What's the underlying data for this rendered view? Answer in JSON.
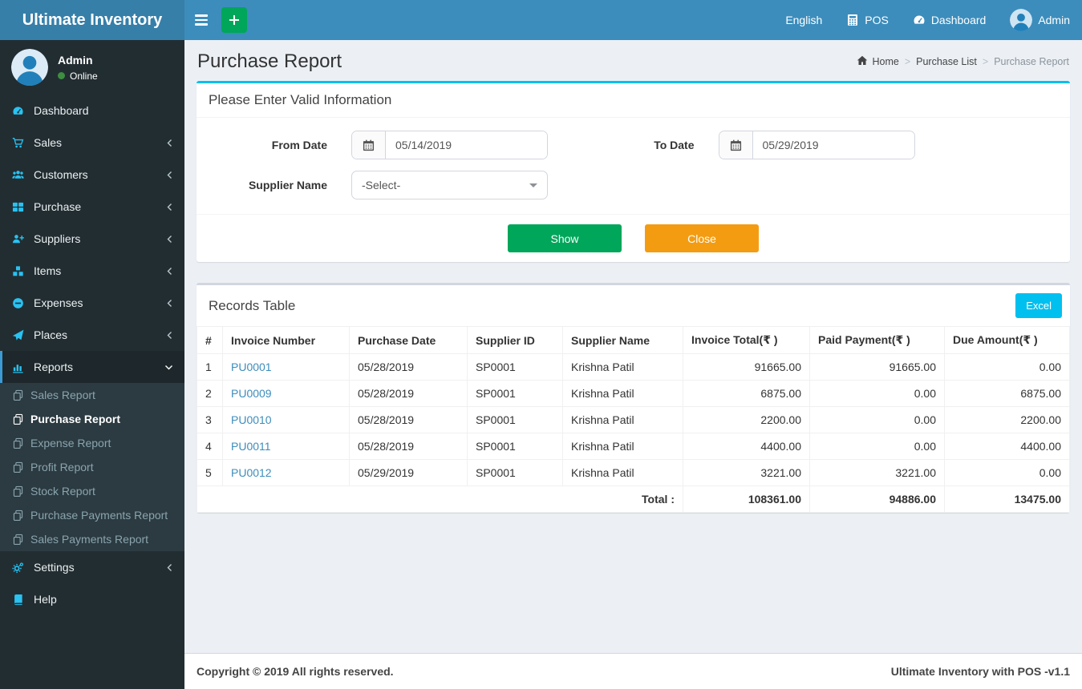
{
  "app": {
    "name": "Ultimate Inventory",
    "footer_left": "Copyright © 2019 All rights reserved.",
    "footer_right": "Ultimate Inventory with POS -v1.1"
  },
  "navbar": {
    "language": "English",
    "pos": "POS",
    "dashboard": "Dashboard",
    "user": "Admin",
    "icons": [
      "calculator-icon",
      "tachometer-icon",
      "user-avatar"
    ]
  },
  "sidebar": {
    "user": {
      "name": "Admin",
      "status": "Online"
    },
    "menu": [
      {
        "label": "Dashboard",
        "icon": "tachometer-icon",
        "arrow": "none",
        "active": false
      },
      {
        "label": "Sales",
        "icon": "cart-icon",
        "arrow": "left",
        "active": false
      },
      {
        "label": "Customers",
        "icon": "users-icon",
        "arrow": "left",
        "active": false
      },
      {
        "label": "Purchase",
        "icon": "th-large-icon",
        "arrow": "left",
        "active": false
      },
      {
        "label": "Suppliers",
        "icon": "user-plus-icon",
        "arrow": "left",
        "active": false
      },
      {
        "label": "Items",
        "icon": "cubes-icon",
        "arrow": "left",
        "active": false
      },
      {
        "label": "Expenses",
        "icon": "minus-circle-icon",
        "arrow": "left",
        "active": false
      },
      {
        "label": "Places",
        "icon": "paper-plane-icon",
        "arrow": "left",
        "active": false
      },
      {
        "label": "Reports",
        "icon": "bar-chart-icon",
        "arrow": "down",
        "active": true,
        "expanded": true
      },
      {
        "label": "Settings",
        "icon": "gears-icon",
        "arrow": "left",
        "active": false
      },
      {
        "label": "Help",
        "icon": "book-icon",
        "arrow": "none",
        "active": false
      }
    ],
    "reports_submenu": [
      {
        "label": "Sales Report",
        "active": false
      },
      {
        "label": "Purchase Report",
        "active": true
      },
      {
        "label": "Expense Report",
        "active": false
      },
      {
        "label": "Profit Report",
        "active": false
      },
      {
        "label": "Stock Report",
        "active": false
      },
      {
        "label": "Purchase Payments Report",
        "active": false
      },
      {
        "label": "Sales Payments Report",
        "active": false
      }
    ]
  },
  "page": {
    "title": "Purchase Report",
    "breadcrumb": {
      "home": "Home",
      "middle": "Purchase List",
      "current": "Purchase Report"
    }
  },
  "filter": {
    "heading": "Please Enter Valid Information",
    "from_date_label": "From Date",
    "from_date_value": "05/14/2019",
    "to_date_label": "To Date",
    "to_date_value": "05/29/2019",
    "supplier_label": "Supplier Name",
    "supplier_value": "-Select-",
    "show_label": "Show",
    "close_label": "Close"
  },
  "records": {
    "heading": "Records Table",
    "excel_label": "Excel",
    "columns": [
      "#",
      "Invoice Number",
      "Purchase Date",
      "Supplier ID",
      "Supplier Name",
      "Invoice Total(₹ )",
      "Paid Payment(₹ )",
      "Due Amount(₹ )"
    ],
    "rows": [
      {
        "num": "1",
        "invoice": "PU0001",
        "date": "05/28/2019",
        "supplier_id": "SP0001",
        "supplier_name": "Krishna Patil",
        "invoice_total": "91665.00",
        "paid": "91665.00",
        "due": "0.00"
      },
      {
        "num": "2",
        "invoice": "PU0009",
        "date": "05/28/2019",
        "supplier_id": "SP0001",
        "supplier_name": "Krishna Patil",
        "invoice_total": "6875.00",
        "paid": "0.00",
        "due": "6875.00"
      },
      {
        "num": "3",
        "invoice": "PU0010",
        "date": "05/28/2019",
        "supplier_id": "SP0001",
        "supplier_name": "Krishna Patil",
        "invoice_total": "2200.00",
        "paid": "0.00",
        "due": "2200.00"
      },
      {
        "num": "4",
        "invoice": "PU0011",
        "date": "05/28/2019",
        "supplier_id": "SP0001",
        "supplier_name": "Krishna Patil",
        "invoice_total": "4400.00",
        "paid": "0.00",
        "due": "4400.00"
      },
      {
        "num": "5",
        "invoice": "PU0012",
        "date": "05/29/2019",
        "supplier_id": "SP0001",
        "supplier_name": "Krishna Patil",
        "invoice_total": "3221.00",
        "paid": "3221.00",
        "due": "0.00"
      }
    ],
    "total_label": "Total :",
    "totals": [
      "108361.00",
      "94886.00",
      "13475.00"
    ]
  },
  "colors": {
    "navbar": "#3c8dbc",
    "logo_bg": "#367fa9",
    "sidebar_bg": "#222d32",
    "submenu_bg": "#2c3b41",
    "accent_cyan": "#00c0ef",
    "green": "#00a65a",
    "orange": "#f39c12",
    "link": "#3c8dbc",
    "content_bg": "#ecf0f5",
    "online_dot": "#3e8e41"
  }
}
